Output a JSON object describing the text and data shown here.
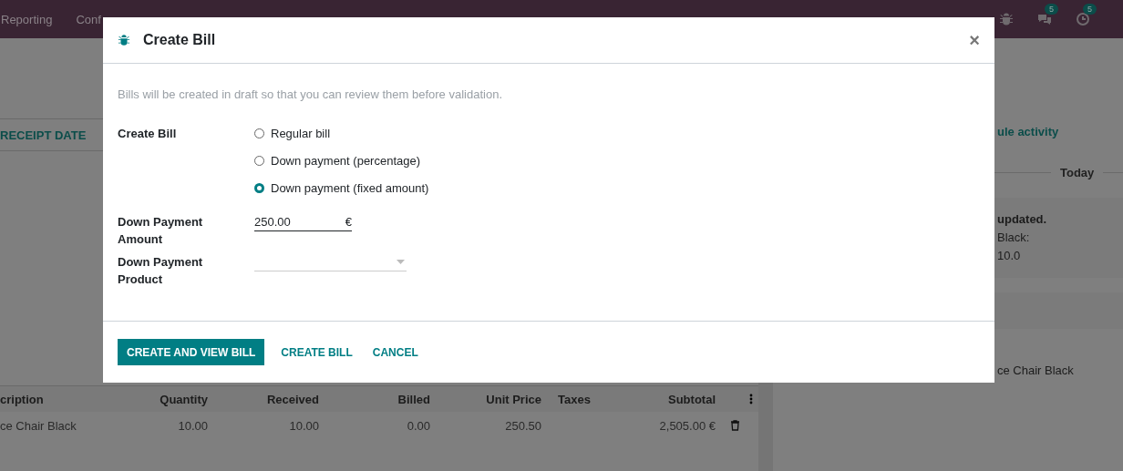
{
  "navbar": {
    "menu": [
      "Reporting",
      "Conf"
    ],
    "badges": [
      {
        "count": "5"
      },
      {
        "count": "5"
      }
    ]
  },
  "background": {
    "tabs": [
      "RECEIPT DATE"
    ],
    "table": {
      "columns": [
        "cription",
        "Quantity",
        "Received",
        "Billed",
        "Unit Price",
        "Taxes",
        "Subtotal"
      ],
      "rows": [
        [
          "ce Chair Black",
          "10.00",
          "10.00",
          "0.00",
          "250.50",
          "",
          "2,505.00 €"
        ]
      ]
    },
    "chatter": {
      "action": "ule activity",
      "date_separator": "Today",
      "message": [
        "updated.",
        "Black:",
        "10.0"
      ],
      "item": "ce Chair Black"
    }
  },
  "dialog": {
    "title": "Create Bill",
    "close": "×",
    "note": "Bills will be created in draft so that you can review them before validation.",
    "bill_type": {
      "label": "Create Bill",
      "options": [
        {
          "label": "Regular bill",
          "selected": false
        },
        {
          "label": "Down payment (percentage)",
          "selected": false
        },
        {
          "label": "Down payment (fixed amount)",
          "selected": true
        }
      ]
    },
    "amount": {
      "label": "Down Payment Amount",
      "value": "250.00",
      "currency": "€"
    },
    "product": {
      "label": "Down Payment Product"
    },
    "buttons": [
      {
        "label": "CREATE AND VIEW BILL",
        "kind": "primary"
      },
      {
        "label": "CREATE BILL",
        "kind": "link"
      },
      {
        "label": "CANCEL",
        "kind": "link"
      }
    ]
  }
}
